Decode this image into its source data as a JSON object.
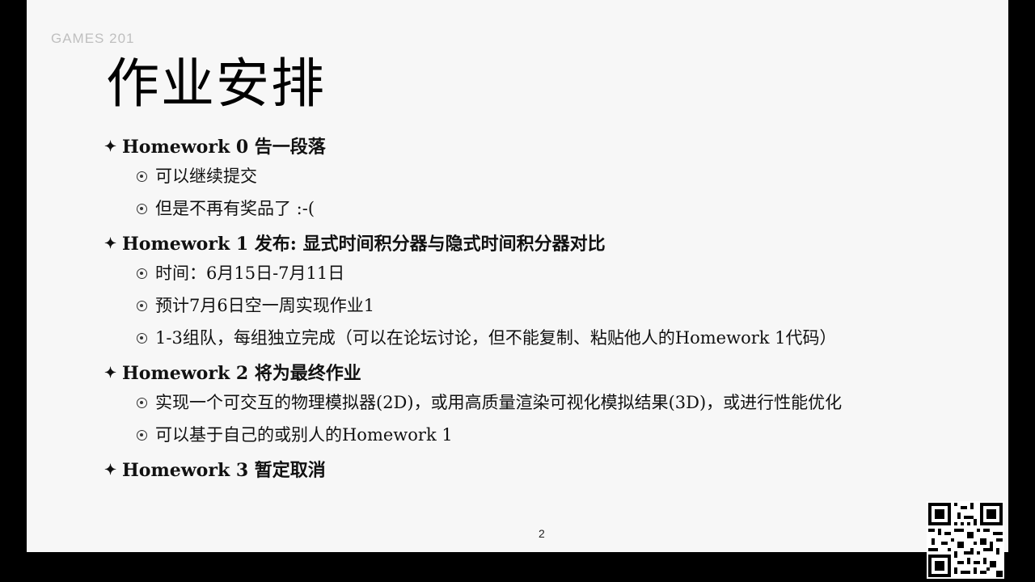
{
  "watermark": "GAMES 201",
  "title": "作业安排",
  "items": [
    {
      "head": "Homework 0 告一段落",
      "subs": [
        "可以继续提交",
        "但是不再有奖品了 :-("
      ]
    },
    {
      "head": "Homework 1 发布: 显式时间积分器与隐式时间积分器对比",
      "subs": [
        "时间：6月15日-7月11日",
        "预计7月6日空一周实现作业1",
        "1-3组队，每组独立完成（可以在论坛讨论，但不能复制、粘贴他人的Homework 1代码）"
      ]
    },
    {
      "head": "Homework 2 将为最终作业",
      "subs": [
        "实现一个可交互的物理模拟器(2D)，或用高质量渲染可视化模拟结果(3D)，或进行性能优化",
        "可以基于自己的或别人的Homework 1"
      ]
    },
    {
      "head": "Homework 3 暂定取消",
      "subs": []
    }
  ],
  "page_number": "2",
  "icons": {
    "head_bullet": "four-pointed-star-icon",
    "sub_bullet": "circled-dot-icon",
    "corner": "qr-code-icon"
  }
}
